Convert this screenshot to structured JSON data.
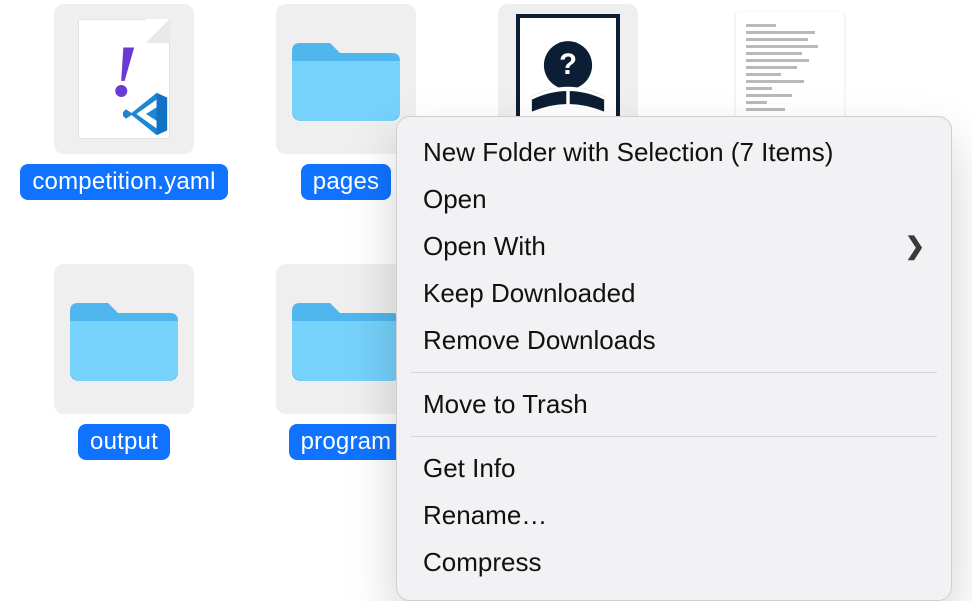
{
  "items": [
    {
      "kind": "yaml-file",
      "label": "competition.yaml"
    },
    {
      "kind": "folder",
      "label": "pages"
    },
    {
      "kind": "book-file",
      "label": ""
    },
    {
      "kind": "text-file",
      "label": ""
    },
    {
      "kind": "folder",
      "label": "output"
    },
    {
      "kind": "folder",
      "label": "program"
    }
  ],
  "context_menu": {
    "groups": [
      [
        {
          "label": "New Folder with Selection (7 Items)",
          "submenu": false
        },
        {
          "label": "Open",
          "submenu": false
        },
        {
          "label": "Open With",
          "submenu": true
        },
        {
          "label": "Keep Downloaded",
          "submenu": false
        },
        {
          "label": "Remove Downloads",
          "submenu": false
        }
      ],
      [
        {
          "label": "Move to Trash",
          "submenu": false
        }
      ],
      [
        {
          "label": "Get Info",
          "submenu": false
        },
        {
          "label": "Rename…",
          "submenu": false
        },
        {
          "label": "Compress",
          "submenu": false
        }
      ]
    ]
  }
}
